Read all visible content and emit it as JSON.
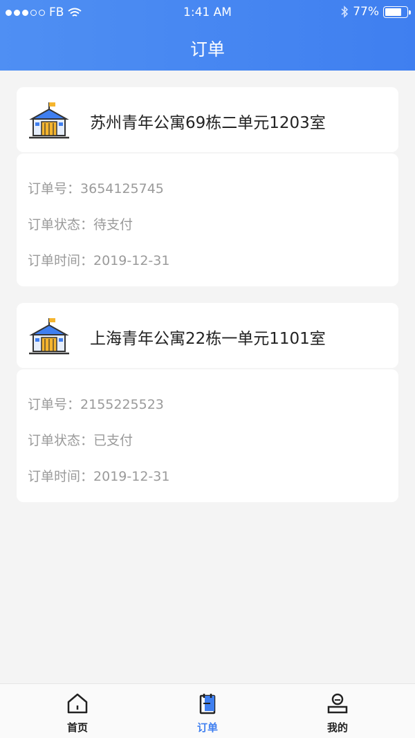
{
  "status_bar": {
    "carrier": "FB",
    "time": "1:41 AM",
    "battery": "77%",
    "battery_level": 0.77,
    "signal_bars_filled": 3,
    "signal_bars_total": 5
  },
  "header": {
    "title": "订单"
  },
  "orders": [
    {
      "apartment": "苏州青年公寓69栋二单元1203室",
      "order_no_label": "订单号：",
      "order_no": "3654125745",
      "status_label": "订单状态：",
      "status": "待支付",
      "time_label": "订单时间：",
      "time": "2019-12-31"
    },
    {
      "apartment": "上海青年公寓22栋一单元1101室",
      "order_no_label": "订单号：",
      "order_no": "2155225523",
      "status_label": "订单状态：",
      "status": "已支付",
      "time_label": "订单时间：",
      "time": "2019-12-31"
    }
  ],
  "tabbar": {
    "tabs": [
      {
        "label": "首页",
        "icon": "home-icon"
      },
      {
        "label": "订单",
        "icon": "order-icon"
      },
      {
        "label": "我的",
        "icon": "user-icon"
      }
    ],
    "active_index": 1
  },
  "colors": {
    "accent": "#3f7ff0",
    "background": "#f4f4f4",
    "card": "#ffffff",
    "muted_text": "#9a9a9a"
  }
}
